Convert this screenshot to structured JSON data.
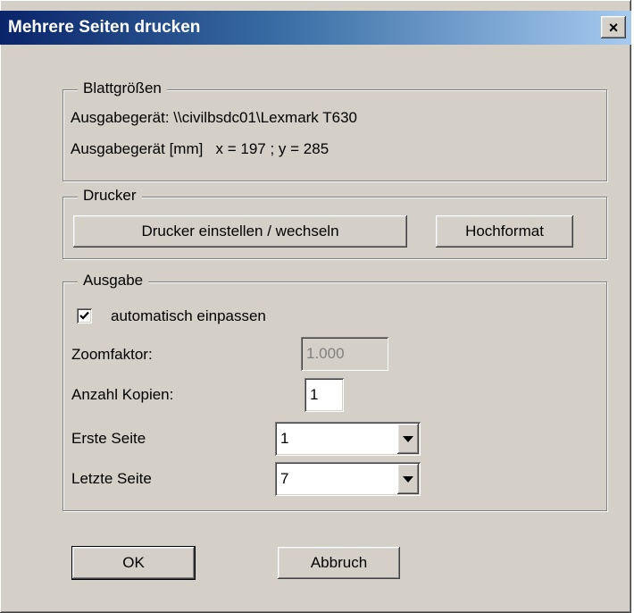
{
  "window": {
    "title": "Mehrere Seiten drucken",
    "close_glyph": "×"
  },
  "blattgroessen": {
    "title": "Blattgrößen",
    "device_line": "Ausgabegerät: \\\\civilbsdc01\\Lexmark T630",
    "size_line": "Ausgabegerät [mm]   x = 197 ; y = 285"
  },
  "drucker": {
    "title": "Drucker",
    "setup_button": "Drucker einstellen / wechseln",
    "orientation_button": "Hochformat"
  },
  "ausgabe": {
    "title": "Ausgabe",
    "auto_fit_label": "automatisch einpassen",
    "auto_fit_checked": true,
    "zoom_label": "Zoomfaktor:",
    "zoom_value": "1.000",
    "copies_label": "Anzahl Kopien:",
    "copies_value": "1",
    "first_page_label": "Erste Seite",
    "first_page_value": "1",
    "last_page_label": "Letzte Seite",
    "last_page_value": "7"
  },
  "buttons": {
    "ok": "OK",
    "cancel": "Abbruch"
  },
  "icons": {
    "checkmark": "checkmark-icon",
    "dropdown": "chevron-down-icon",
    "close": "close-icon"
  }
}
